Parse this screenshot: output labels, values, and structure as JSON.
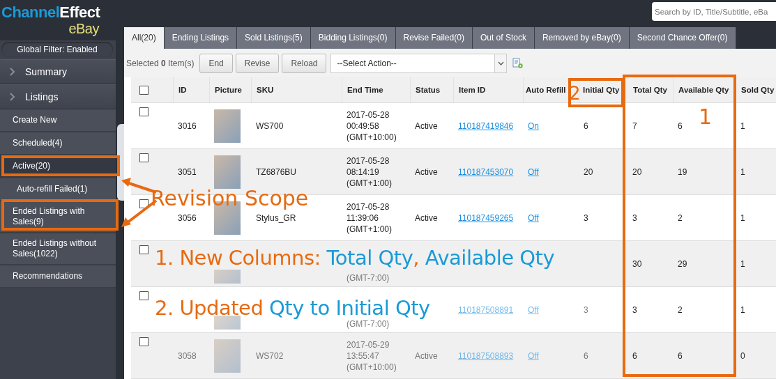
{
  "logo": {
    "channel": "Channel",
    "effect": "Effect",
    "market": "eBay"
  },
  "global_filter": "Global Filter: Enabled",
  "sidebar": {
    "sections": [
      {
        "label": "Summary",
        "expanded": false
      },
      {
        "label": "Listings",
        "expanded": false
      }
    ],
    "items": [
      {
        "label": "Create New",
        "selected": false
      },
      {
        "label": "Scheduled(4)",
        "selected": false
      },
      {
        "label": "Active(20)",
        "selected": true,
        "children": [
          {
            "label": "Auto-refill Failed(1)",
            "selected": false
          }
        ]
      },
      {
        "label": "Ended Listings with Sales(9)",
        "selected": false
      },
      {
        "label": "Ended Listings without Sales(1022)",
        "selected": false
      },
      {
        "label": "Recommendations",
        "selected": false
      }
    ]
  },
  "search": {
    "placeholder": "Search by ID, Title/Subtitle, eBa"
  },
  "tabs": [
    {
      "label": "All(20)",
      "selected": true
    },
    {
      "label": "Ending Listings",
      "selected": false
    },
    {
      "label": "Sold Listings(5)",
      "selected": false
    },
    {
      "label": "Bidding Listings(0)",
      "selected": false
    },
    {
      "label": "Revise Failed(0)",
      "selected": false
    },
    {
      "label": "Out of Stock",
      "selected": false
    },
    {
      "label": "Removed by eBay(0)",
      "selected": false
    },
    {
      "label": "Second Chance Offer(0)",
      "selected": false
    }
  ],
  "toolbar": {
    "selected_prefix": "Selected",
    "selected_count": "0",
    "selected_suffix": "Item(s)",
    "buttons": [
      "End",
      "Revise",
      "Reload"
    ],
    "action_select": "--Select Action--"
  },
  "table": {
    "select_all": {
      "checked": false
    },
    "columns": [
      "ID",
      "Picture",
      "SKU",
      "End Time",
      "Status",
      "Item ID",
      "Auto Refill",
      "Initial Qty",
      "Total Qty",
      "Available Qty",
      "Sold Qty"
    ],
    "rows": [
      {
        "checked": false,
        "dimmed": false,
        "id": "3016",
        "sku": "WS700",
        "end_time": [
          "2017-05-28",
          "00:49:58",
          "(GMT+10:00)"
        ],
        "status": "Active",
        "item_id": "110187419846",
        "auto_refill": "On",
        "initial_qty": "6",
        "total_qty": "7",
        "available_qty": "6",
        "sold_qty": "1"
      },
      {
        "checked": false,
        "dimmed": false,
        "id": "3051",
        "sku": "TZ6876BU",
        "end_time": [
          "2017-05-28",
          "08:14:19",
          "(GMT+1:00)"
        ],
        "status": "Active",
        "item_id": "110187453070",
        "auto_refill": "Off",
        "initial_qty": "20",
        "total_qty": "20",
        "available_qty": "19",
        "sold_qty": "1"
      },
      {
        "checked": false,
        "dimmed": false,
        "id": "3056",
        "sku": "Stylus_GR",
        "end_time": [
          "2017-05-28",
          "11:39:06",
          "(GMT+1:00)"
        ],
        "status": "Active",
        "item_id": "110187459265",
        "auto_refill": "Off",
        "initial_qty": "3",
        "total_qty": "3",
        "available_qty": "2",
        "sold_qty": "1"
      },
      {
        "checked": false,
        "dimmed": true,
        "end_time": [
          "(GMT-7:00)"
        ],
        "total_qty": "30",
        "available_qty": "29",
        "sold_qty": "1"
      },
      {
        "checked": false,
        "dimmed": true,
        "end_time": [
          "(GMT-7:00)"
        ],
        "item_id": "110187508891",
        "auto_refill": "Off",
        "initial_qty": "3",
        "total_qty": "3",
        "available_qty": "2",
        "sold_qty": "1"
      },
      {
        "checked": false,
        "dimmed": true,
        "id": "3058",
        "sku": "WS702",
        "end_time": [
          "2017-05-29",
          "13:55:47",
          "(GMT+10:00)"
        ],
        "status": "Active",
        "item_id": "110187508893",
        "auto_refill": "Off",
        "initial_qty": "6",
        "total_qty": "6",
        "available_qty": "6",
        "sold_qty": "0"
      }
    ]
  },
  "annotations": {
    "scope_label": "Revision Scope",
    "marker_columns": "1",
    "marker_initial": "2",
    "notes": [
      [
        {
          "text": "1. New Columns:",
          "kind": "plain"
        },
        {
          "text": "Total Qty",
          "kind": "highlight",
          "suffix": ","
        },
        {
          "text": "Available Qty",
          "kind": "highlight"
        }
      ],
      [
        {
          "text": "2. Updated",
          "kind": "plain"
        },
        {
          "text": "Qty to Initial Qty",
          "kind": "highlight"
        }
      ]
    ]
  }
}
